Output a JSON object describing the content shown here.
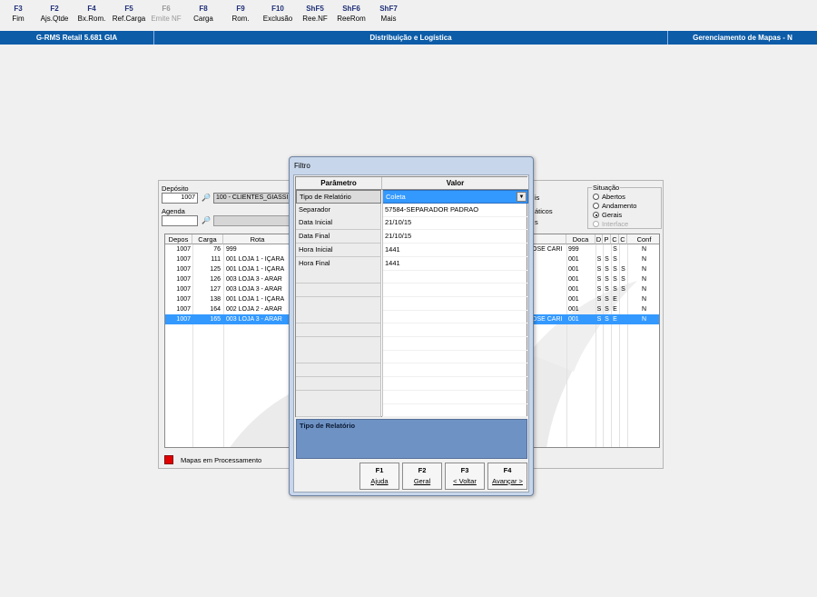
{
  "toolbar": [
    {
      "key": "F3",
      "label": "Fim",
      "enabled": true
    },
    {
      "key": "F2",
      "label": "Ajs.Qtde",
      "enabled": true
    },
    {
      "key": "F4",
      "label": "Bx.Rom.",
      "enabled": true
    },
    {
      "key": "F5",
      "label": "Ref.Carga",
      "enabled": true
    },
    {
      "key": "F6",
      "label": "Emite NF",
      "enabled": false
    },
    {
      "key": "F8",
      "label": "Carga",
      "enabled": true
    },
    {
      "key": "F9",
      "label": "Rom.",
      "enabled": true
    },
    {
      "key": "F10",
      "label": "Exclusão",
      "enabled": true
    },
    {
      "key": "ShF5",
      "label": "Ree.NF",
      "enabled": true
    },
    {
      "key": "ShF6",
      "label": "ReeRom",
      "enabled": true
    },
    {
      "key": "ShF7",
      "label": "Mais",
      "enabled": true
    }
  ],
  "titlebar": {
    "app": "G-RMS Retail 5.681 GIA",
    "module": "Distribuição e Logística",
    "screen": "Gerenciamento de Mapas - N"
  },
  "main": {
    "deposito_label": "Depósito",
    "deposito_value": "1007",
    "deposito_desc": "100 - CLIENTES_GIASSI",
    "agenda_label": "Agenda",
    "agenda_value": "",
    "mid_labels": [
      "is",
      "áticos",
      "s"
    ],
    "situacao": {
      "legend": "Situação",
      "options": [
        {
          "label": "Abertos",
          "checked": false,
          "enabled": true
        },
        {
          "label": "Andamento",
          "checked": false,
          "enabled": true
        },
        {
          "label": "Gerais",
          "checked": true,
          "enabled": true
        },
        {
          "label": "Interface",
          "checked": false,
          "enabled": false
        }
      ]
    },
    "grid": {
      "left_headers": [
        "Depos",
        "Carga",
        "Rota"
      ],
      "right_headers": [
        "Doca",
        "D",
        "P",
        "C",
        "C",
        "Conf"
      ],
      "rows": [
        {
          "depos": "1007",
          "carga": "76",
          "rota": "999",
          "extra": "OSE CARI",
          "doca": "999",
          "d": "",
          "p": "",
          "c1": "S",
          "c2": "",
          "conf": "N",
          "selected": false
        },
        {
          "depos": "1007",
          "carga": "111",
          "rota": "001  LOJA 1 - IÇARA",
          "extra": "",
          "doca": "001",
          "d": "S",
          "p": "S",
          "c1": "S",
          "c2": "",
          "conf": "N",
          "selected": false
        },
        {
          "depos": "1007",
          "carga": "125",
          "rota": "001  LOJA 1 - IÇARA",
          "extra": "",
          "doca": "001",
          "d": "S",
          "p": "S",
          "c1": "S",
          "c2": "S",
          "conf": "N",
          "selected": false
        },
        {
          "depos": "1007",
          "carga": "126",
          "rota": "003  LOJA 3 - ARAR",
          "extra": "",
          "doca": "001",
          "d": "S",
          "p": "S",
          "c1": "S",
          "c2": "S",
          "conf": "N",
          "selected": false
        },
        {
          "depos": "1007",
          "carga": "127",
          "rota": "003  LOJA 3 - ARAR",
          "extra": "",
          "doca": "001",
          "d": "S",
          "p": "S",
          "c1": "S",
          "c2": "S",
          "conf": "N",
          "selected": false
        },
        {
          "depos": "1007",
          "carga": "138",
          "rota": "001  LOJA 1 - IÇARA",
          "extra": "",
          "doca": "001",
          "d": "S",
          "p": "S",
          "c1": "E",
          "c2": "",
          "conf": "N",
          "selected": false
        },
        {
          "depos": "1007",
          "carga": "164",
          "rota": "002  LOJA 2 - ARAR",
          "extra": "",
          "doca": "001",
          "d": "S",
          "p": "S",
          "c1": "E",
          "c2": "",
          "conf": "N",
          "selected": false
        },
        {
          "depos": "1007",
          "carga": "165",
          "rota": "003  LOJA 3 - ARAR",
          "extra": "OSE CARI",
          "doca": "001",
          "d": "S",
          "p": "S",
          "c1": "E",
          "c2": "",
          "conf": "N",
          "selected": true
        }
      ]
    },
    "legend_text": "Mapas em Processamento",
    "legend_color": "#e00000"
  },
  "dialog": {
    "title": "Filtro",
    "headers": {
      "param": "Parâmetro",
      "value": "Valor"
    },
    "rows": [
      {
        "param": "Tipo de Relatório",
        "value": "Coleta"
      },
      {
        "param": "Separador",
        "value": "57584-SEPARADOR PADRAO"
      },
      {
        "param": "Data Inicial",
        "value": "21/10/15"
      },
      {
        "param": "Data Final",
        "value": "21/10/15"
      },
      {
        "param": "Hora Inicial",
        "value": "1441"
      },
      {
        "param": "Hora Final",
        "value": "1441"
      }
    ],
    "description": "Tipo de Relatório",
    "buttons": [
      {
        "key": "F1",
        "label": "Ajuda"
      },
      {
        "key": "F2",
        "label": "Geral"
      },
      {
        "key": "F3",
        "label": "< Voltar"
      },
      {
        "key": "F4",
        "label": "Avançar >"
      }
    ]
  },
  "colors": {
    "titlebar": "#0c5ca8",
    "selection": "#3399ff",
    "description_panel": "#6e92c4",
    "toolbar_key": "#1f2f77"
  }
}
